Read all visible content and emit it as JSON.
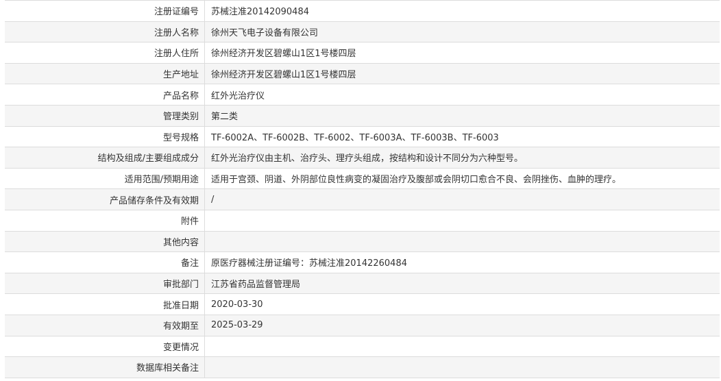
{
  "record": {
    "rows": [
      {
        "label": "注册证编号",
        "value": "苏械注准20142090484"
      },
      {
        "label": "注册人名称",
        "value": "徐州天飞电子设备有限公司"
      },
      {
        "label": "注册人住所",
        "value": "徐州经济开发区碧螺山1区1号楼四层"
      },
      {
        "label": "生产地址",
        "value": "徐州经济开发区碧螺山1区1号楼四层"
      },
      {
        "label": "产品名称",
        "value": "红外光治疗仪"
      },
      {
        "label": "管理类别",
        "value": "第二类"
      },
      {
        "label": "型号规格",
        "value": "TF-6002A、TF-6002B、TF-6002、TF-6003A、TF-6003B、TF-6003"
      },
      {
        "label": "结构及组成/主要组成成分",
        "value": "红外光治疗仪由主机、治疗头、理疗头组成，按结构和设计不同分为六种型号。"
      },
      {
        "label": "适用范围/预期用途",
        "value": "适用于宫颈、阴道、外阴部位良性病变的凝固治疗及腹部或会阴切口愈合不良、会阴挫伤、血肿的理疗。"
      },
      {
        "label": "产品储存条件及有效期",
        "value": "/"
      },
      {
        "label": "附件",
        "value": ""
      },
      {
        "label": "其他内容",
        "value": ""
      },
      {
        "label": "备注",
        "value": "原医疗器械注册证编号：苏械注准20142260484"
      },
      {
        "label": "审批部门",
        "value": "江苏省药品监督管理局"
      },
      {
        "label": "批准日期",
        "value": "2020-03-30"
      },
      {
        "label": "有效期至",
        "value": "2025-03-29"
      },
      {
        "label": "变更情况",
        "value": ""
      },
      {
        "label": "数据库相关备注",
        "value": ""
      }
    ]
  }
}
